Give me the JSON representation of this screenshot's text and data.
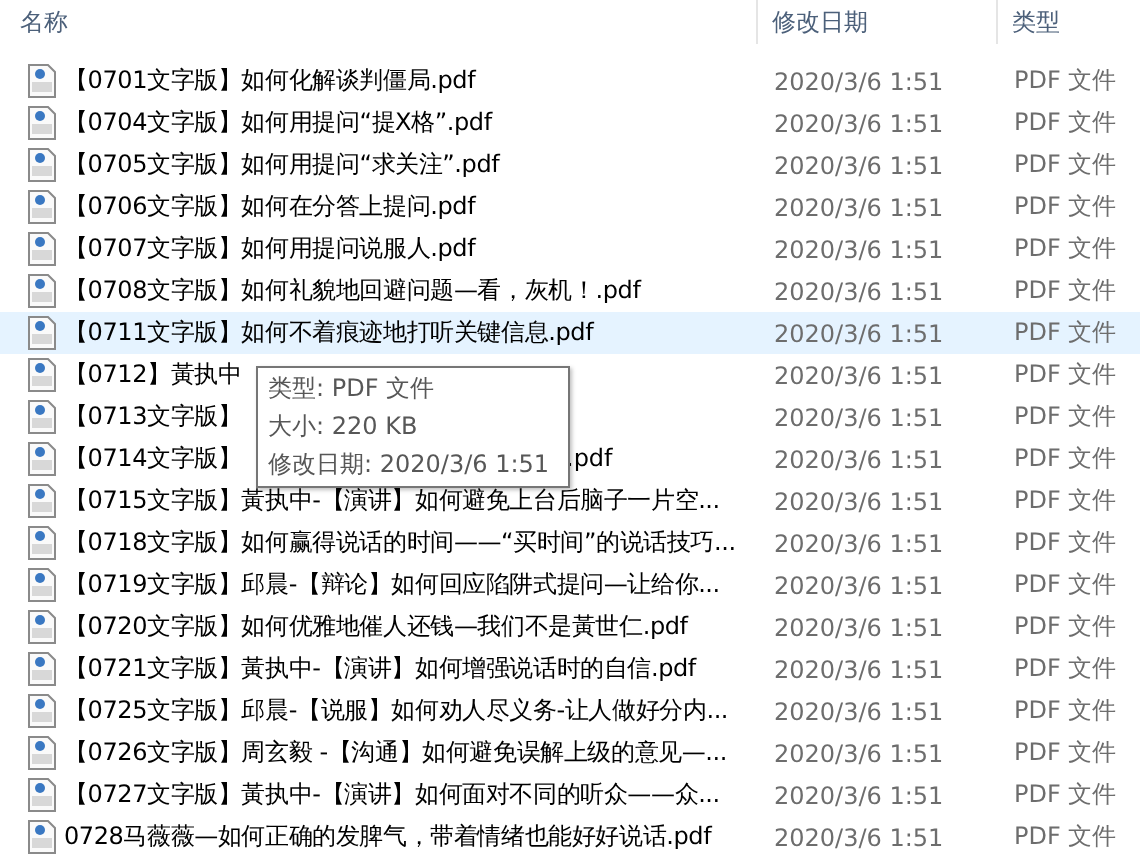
{
  "columns": [
    {
      "label": "名称"
    },
    {
      "label": "修改日期"
    },
    {
      "label": "类型"
    }
  ],
  "rows": [
    {
      "name": "【0701文字版】如何化解谈判僵局.pdf",
      "date": "2020/3/6 1:51",
      "type": "PDF 文件",
      "hovered": false
    },
    {
      "name": "【0704文字版】如何用提问“提X格”.pdf",
      "date": "2020/3/6 1:51",
      "type": "PDF 文件",
      "hovered": false
    },
    {
      "name": "【0705文字版】如何用提问“求关注”.pdf",
      "date": "2020/3/6 1:51",
      "type": "PDF 文件",
      "hovered": false
    },
    {
      "name": "【0706文字版】如何在分答上提问.pdf",
      "date": "2020/3/6 1:51",
      "type": "PDF 文件",
      "hovered": false
    },
    {
      "name": "【0707文字版】如何用提问说服人.pdf",
      "date": "2020/3/6 1:51",
      "type": "PDF 文件",
      "hovered": false
    },
    {
      "name": "【0708文字版】如何礼貌地回避问题—看，灰机！.pdf",
      "date": "2020/3/6 1:51",
      "type": "PDF 文件",
      "hovered": false
    },
    {
      "name": "【0711文字版】如何不着痕迹地打听关键信息.pdf",
      "date": "2020/3/6 1:51",
      "type": "PDF 文件",
      "hovered": true
    },
    {
      "name": "【0712】黃执中",
      "date": "2020/3/6 1:51",
      "type": "PDF 文件",
      "hovered": false
    },
    {
      "name": "【0713文字版】",
      "date": "2020/3/6 1:51",
      "type": "PDF 文件",
      "hovered": false
    },
    {
      "name": "【0714文字版】",
      "name_tail": ".pdf",
      "date": "2020/3/6 1:51",
      "type": "PDF 文件",
      "hovered": false
    },
    {
      "name": "【0715文字版】黃执中-【演讲】如何避免上台后脑子一片空...",
      "date": "2020/3/6 1:51",
      "type": "PDF 文件",
      "hovered": false
    },
    {
      "name": "【0718文字版】如何赢得说话的时间——“买时间”的说话技巧...",
      "date": "2020/3/6 1:51",
      "type": "PDF 文件",
      "hovered": false
    },
    {
      "name": "【0719文字版】邱晨-【辩论】如何回应陷阱式提问—让给你...",
      "date": "2020/3/6 1:51",
      "type": "PDF 文件",
      "hovered": false
    },
    {
      "name": "【0720文字版】如何优雅地催人还钱—我们不是黃世仁.pdf",
      "date": "2020/3/6 1:51",
      "type": "PDF 文件",
      "hovered": false
    },
    {
      "name": "【0721文字版】黃执中-【演讲】如何增强说话时的自信.pdf",
      "date": "2020/3/6 1:51",
      "type": "PDF 文件",
      "hovered": false
    },
    {
      "name": "【0725文字版】邱晨-【说服】如何劝人尽义务-让人做好分内...",
      "date": "2020/3/6 1:51",
      "type": "PDF 文件",
      "hovered": false
    },
    {
      "name": "【0726文字版】周玄毅 -【沟通】如何避免误解上级的意见—...",
      "date": "2020/3/6 1:51",
      "type": "PDF 文件",
      "hovered": false
    },
    {
      "name": "【0727文字版】黃执中-【演讲】如何面对不同的听众——众...",
      "date": "2020/3/6 1:51",
      "type": "PDF 文件",
      "hovered": false
    },
    {
      "name": "0728马薇薇—如何正确的发脾气，带着情绪也能好好说话.pdf",
      "date": "2020/3/6 1:51",
      "type": "PDF 文件",
      "hovered": false
    }
  ],
  "tooltip": {
    "lines": [
      {
        "label": "类型:",
        "value": "PDF 文件"
      },
      {
        "label": "大小:",
        "value": "220 KB"
      },
      {
        "label": "修改日期:",
        "value": "2020/3/6 1:51"
      }
    ]
  }
}
